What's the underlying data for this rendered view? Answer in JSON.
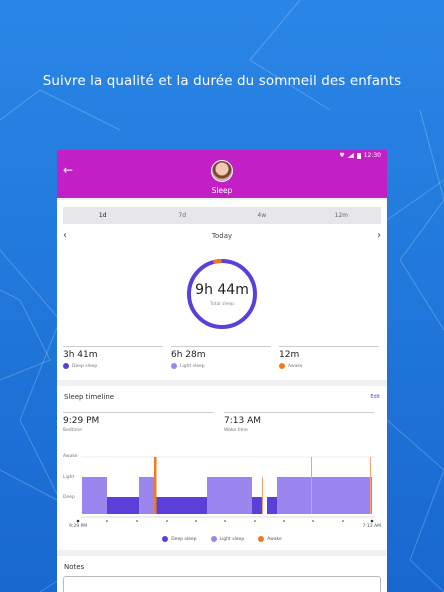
{
  "tagline": "Suivre la qualité et la durée du sommeil des enfants",
  "statusbar": {
    "time": "12:30"
  },
  "appbar": {
    "title": "Sleep"
  },
  "tabs": [
    {
      "label": "1d",
      "active": true
    },
    {
      "label": "7d",
      "active": false
    },
    {
      "label": "4w",
      "active": false
    },
    {
      "label": "12m",
      "active": false
    }
  ],
  "date_nav": {
    "label": "Today"
  },
  "summary": {
    "total_value": "9h 44m",
    "total_label": "Total sleep",
    "ring_awake_fraction": 0.04,
    "stats": [
      {
        "value": "3h 41m",
        "label": "Deep sleep",
        "color": "#5b3fd9"
      },
      {
        "value": "6h 28m",
        "label": "Light sleep",
        "color": "#9b86ef"
      },
      {
        "value": "12m",
        "label": "Awake",
        "color": "#f07a22"
      }
    ]
  },
  "timeline": {
    "title": "Sleep timeline",
    "edit_label": "Edit",
    "bedtime_value": "9:29 PM",
    "bedtime_label": "Bedtime",
    "wake_value": "7:13 AM",
    "wake_label": "Wake time",
    "y_labels": [
      "Awake",
      "Light",
      "Deep"
    ],
    "x_start": "9:29 PM",
    "x_end": "7:13 AM",
    "legend": [
      {
        "label": "Deep sleep",
        "color": "#5b3fd9"
      },
      {
        "label": "Light sleep",
        "color": "#9b86ef"
      },
      {
        "label": "Awake",
        "color": "#f07a22"
      }
    ]
  },
  "notes": {
    "label": "Notes"
  },
  "colors": {
    "appbar": "#c31fc6",
    "deep": "#5b3fd9",
    "light": "#9b86ef",
    "awake": "#f07a22",
    "background": "#1f76dc"
  }
}
